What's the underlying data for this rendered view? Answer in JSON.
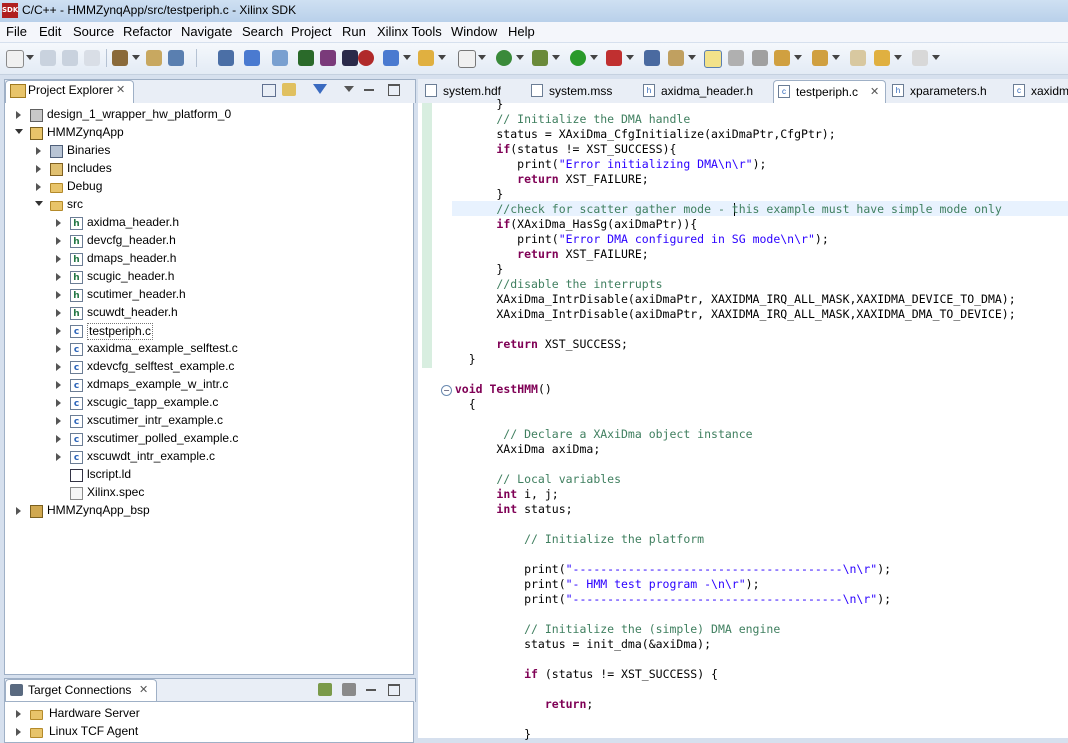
{
  "window": {
    "title": "C/C++ - HMMZynqApp/src/testperiph.c - Xilinx SDK",
    "logo": "SDK"
  },
  "menu": [
    "File",
    "Edit",
    "Source",
    "Refactor",
    "Navigate",
    "Search",
    "Project",
    "Run",
    "Xilinx Tools",
    "Window",
    "Help"
  ],
  "project_explorer": {
    "title": "Project Explorer",
    "items": [
      {
        "label": "design_1_wrapper_hw_platform_0",
        "depth": 0,
        "expander": "collapsed",
        "icon": "hw-platform-icon"
      },
      {
        "label": "HMMZynqApp",
        "depth": 0,
        "expander": "expanded",
        "icon": "project-icon"
      },
      {
        "label": "Binaries",
        "depth": 1,
        "expander": "collapsed",
        "icon": "binaries-icon"
      },
      {
        "label": "Includes",
        "depth": 1,
        "expander": "collapsed",
        "icon": "includes-icon"
      },
      {
        "label": "Debug",
        "depth": 1,
        "expander": "collapsed",
        "icon": "folder-icon"
      },
      {
        "label": "src",
        "depth": 1,
        "expander": "expanded",
        "icon": "folder-icon"
      },
      {
        "label": "axidma_header.h",
        "depth": 2,
        "expander": "collapsed",
        "icon": "h-file-icon"
      },
      {
        "label": "devcfg_header.h",
        "depth": 2,
        "expander": "collapsed",
        "icon": "h-file-icon"
      },
      {
        "label": "dmaps_header.h",
        "depth": 2,
        "expander": "collapsed",
        "icon": "h-file-icon"
      },
      {
        "label": "scugic_header.h",
        "depth": 2,
        "expander": "collapsed",
        "icon": "h-file-icon"
      },
      {
        "label": "scutimer_header.h",
        "depth": 2,
        "expander": "collapsed",
        "icon": "h-file-icon"
      },
      {
        "label": "scuwdt_header.h",
        "depth": 2,
        "expander": "collapsed",
        "icon": "h-file-icon"
      },
      {
        "label": "testperiph.c",
        "depth": 2,
        "expander": "collapsed",
        "icon": "c-file-icon",
        "selected": true
      },
      {
        "label": "xaxidma_example_selftest.c",
        "depth": 2,
        "expander": "collapsed",
        "icon": "c-file-icon"
      },
      {
        "label": "xdevcfg_selftest_example.c",
        "depth": 2,
        "expander": "collapsed",
        "icon": "c-file-icon"
      },
      {
        "label": "xdmaps_example_w_intr.c",
        "depth": 2,
        "expander": "collapsed",
        "icon": "c-file-icon"
      },
      {
        "label": "xscugic_tapp_example.c",
        "depth": 2,
        "expander": "collapsed",
        "icon": "c-file-icon"
      },
      {
        "label": "xscutimer_intr_example.c",
        "depth": 2,
        "expander": "collapsed",
        "icon": "c-file-icon"
      },
      {
        "label": "xscutimer_polled_example.c",
        "depth": 2,
        "expander": "collapsed",
        "icon": "c-file-icon"
      },
      {
        "label": "xscuwdt_intr_example.c",
        "depth": 2,
        "expander": "collapsed",
        "icon": "c-file-icon"
      },
      {
        "label": "lscript.ld",
        "depth": 2,
        "expander": "none",
        "icon": "linker-script-icon"
      },
      {
        "label": "Xilinx.spec",
        "depth": 2,
        "expander": "none",
        "icon": "spec-file-icon"
      },
      {
        "label": "HMMZynqApp_bsp",
        "depth": 0,
        "expander": "collapsed",
        "icon": "bsp-icon"
      }
    ]
  },
  "target_connections": {
    "title": "Target Connections",
    "items": [
      {
        "label": "Hardware Server"
      },
      {
        "label": "Linux TCF Agent"
      }
    ]
  },
  "editor_tabs": [
    {
      "label": "system.hdf",
      "icon": "hdf-icon"
    },
    {
      "label": "system.mss",
      "icon": "mss-icon"
    },
    {
      "label": "axidma_header.h",
      "icon": "h-file-icon"
    },
    {
      "label": "testperiph.c",
      "icon": "c-file-icon",
      "active": true
    },
    {
      "label": "xparameters.h",
      "icon": "h-file-icon"
    },
    {
      "label": "xaxidm",
      "icon": "c-file-icon"
    }
  ],
  "code_lines": [
    [
      {
        "t": "        }",
        "c": ""
      }
    ],
    [
      {
        "t": "        // Initialize the DMA handle",
        "c": "cm"
      }
    ],
    [
      {
        "t": "        status = XAxiDma_CfgInitialize(axiDmaPtr,CfgPtr);",
        "c": ""
      }
    ],
    [
      {
        "t": "        ",
        "c": ""
      },
      {
        "t": "if",
        "c": "kw"
      },
      {
        "t": "(status != XST_SUCCESS){",
        "c": ""
      }
    ],
    [
      {
        "t": "           print(",
        "c": ""
      },
      {
        "t": "\"Error initializing DMA\\n\\r\"",
        "c": "st"
      },
      {
        "t": ");",
        "c": ""
      }
    ],
    [
      {
        "t": "           ",
        "c": ""
      },
      {
        "t": "return",
        "c": "kw"
      },
      {
        "t": " XST_FAILURE;",
        "c": ""
      }
    ],
    [
      {
        "t": "        }",
        "c": ""
      }
    ],
    [
      {
        "t": "        //check for scatter gather mode - this example must have simple mode only",
        "c": "cm"
      }
    ],
    [
      {
        "t": "        ",
        "c": ""
      },
      {
        "t": "if",
        "c": "kw"
      },
      {
        "t": "(XAxiDma_HasSg(axiDmaPtr)){",
        "c": ""
      }
    ],
    [
      {
        "t": "           print(",
        "c": ""
      },
      {
        "t": "\"Error DMA configured in SG mode\\n\\r\"",
        "c": "st"
      },
      {
        "t": ");",
        "c": ""
      }
    ],
    [
      {
        "t": "           ",
        "c": ""
      },
      {
        "t": "return",
        "c": "kw"
      },
      {
        "t": " XST_FAILURE;",
        "c": ""
      }
    ],
    [
      {
        "t": "        }",
        "c": ""
      }
    ],
    [
      {
        "t": "        //disable the interrupts",
        "c": "cm"
      }
    ],
    [
      {
        "t": "        XAxiDma_IntrDisable(axiDmaPtr, XAXIDMA_IRQ_ALL_MASK,XAXIDMA_DEVICE_TO_DMA);",
        "c": ""
      }
    ],
    [
      {
        "t": "        XAxiDma_IntrDisable(axiDmaPtr, XAXIDMA_IRQ_ALL_MASK,XAXIDMA_DMA_TO_DEVICE);",
        "c": ""
      }
    ],
    [
      {
        "t": "",
        "c": ""
      }
    ],
    [
      {
        "t": "        ",
        "c": ""
      },
      {
        "t": "return",
        "c": "kw"
      },
      {
        "t": " XST_SUCCESS;",
        "c": ""
      }
    ],
    [
      {
        "t": "    }",
        "c": ""
      }
    ],
    [
      {
        "t": "",
        "c": ""
      }
    ],
    [
      {
        "t": "  ",
        "c": ""
      },
      {
        "t": "void",
        "c": "kw"
      },
      {
        "t": " ",
        "c": ""
      },
      {
        "t": "TestHMM",
        "c": "kw"
      },
      {
        "t": "()",
        "c": ""
      }
    ],
    [
      {
        "t": "    {",
        "c": ""
      }
    ],
    [
      {
        "t": "",
        "c": ""
      }
    ],
    [
      {
        "t": "         // Declare a XAxiDma object instance",
        "c": "cm"
      }
    ],
    [
      {
        "t": "        XAxiDma axiDma;",
        "c": ""
      }
    ],
    [
      {
        "t": "",
        "c": ""
      }
    ],
    [
      {
        "t": "        // Local variables",
        "c": "cm"
      }
    ],
    [
      {
        "t": "        ",
        "c": ""
      },
      {
        "t": "int",
        "c": "kw"
      },
      {
        "t": " i, j;",
        "c": ""
      }
    ],
    [
      {
        "t": "        ",
        "c": ""
      },
      {
        "t": "int",
        "c": "kw"
      },
      {
        "t": " status;",
        "c": ""
      }
    ],
    [
      {
        "t": "",
        "c": ""
      }
    ],
    [
      {
        "t": "            // Initialize the platform",
        "c": "cm"
      }
    ],
    [
      {
        "t": "",
        "c": ""
      }
    ],
    [
      {
        "t": "            print(",
        "c": ""
      },
      {
        "t": "\"---------------------------------------\\n\\r\"",
        "c": "st"
      },
      {
        "t": ");",
        "c": ""
      }
    ],
    [
      {
        "t": "            print(",
        "c": ""
      },
      {
        "t": "\"- HMM test program -\\n\\r\"",
        "c": "st"
      },
      {
        "t": ");",
        "c": ""
      }
    ],
    [
      {
        "t": "            print(",
        "c": ""
      },
      {
        "t": "\"---------------------------------------\\n\\r\"",
        "c": "st"
      },
      {
        "t": ");",
        "c": ""
      }
    ],
    [
      {
        "t": "",
        "c": ""
      }
    ],
    [
      {
        "t": "            // Initialize the (simple) DMA engine",
        "c": "cm"
      }
    ],
    [
      {
        "t": "            status = init_dma(&axiDma);",
        "c": ""
      }
    ],
    [
      {
        "t": "",
        "c": ""
      }
    ],
    [
      {
        "t": "            ",
        "c": ""
      },
      {
        "t": "if",
        "c": "kw"
      },
      {
        "t": " (status != XST_SUCCESS) {",
        "c": ""
      }
    ],
    [
      {
        "t": "",
        "c": ""
      }
    ],
    [
      {
        "t": "               ",
        "c": ""
      },
      {
        "t": "return",
        "c": "kw"
      },
      {
        "t": ";",
        "c": ""
      }
    ],
    [
      {
        "t": "",
        "c": ""
      }
    ],
    [
      {
        "t": "            }",
        "c": ""
      }
    ]
  ]
}
